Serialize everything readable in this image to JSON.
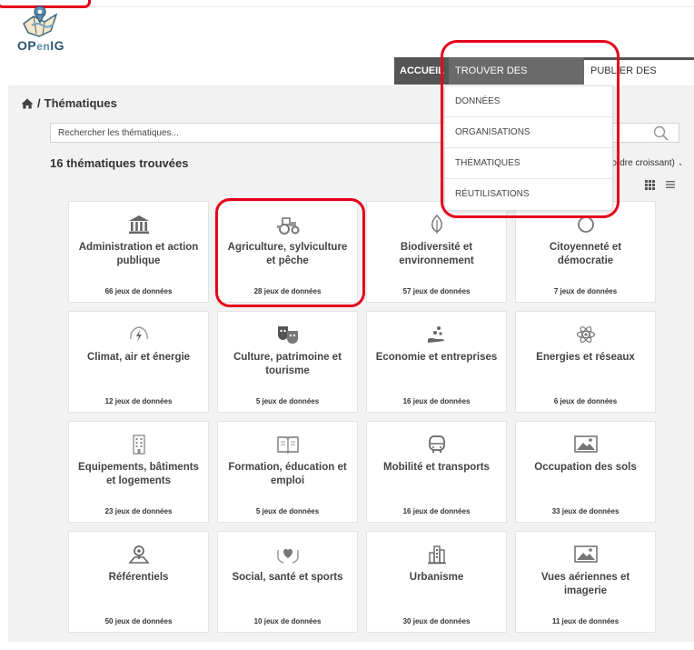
{
  "brand": {
    "logo_main": "OP",
    "logo_en": "en",
    "logo_end": "IG"
  },
  "nav": {
    "accueil": "ACCUEIL",
    "trouver": "TROUVER DES DONNÉES",
    "publier": "PUBLIER DES DONNÉES"
  },
  "dropdown": {
    "items": [
      "DONNÉES",
      "ORGANISATIONS",
      "THÉMATIQUES",
      "RÉUTILISATIONS"
    ]
  },
  "breadcrumb": {
    "separator": "/",
    "current": "Thématiques"
  },
  "search": {
    "placeholder": "Rechercher les thématiques..."
  },
  "results": {
    "count_label": "16 thématiques trouvées",
    "sort_label": "(ordre croissant) ⌄"
  },
  "colors": {
    "annotation": "#e3001b",
    "nav_dark": "#555555",
    "nav_mid": "#6a6a6a",
    "background": "#f2f2f2"
  },
  "themes": [
    {
      "icon": "bank-icon",
      "title": "Administration et action publique",
      "count": "66 jeux de données"
    },
    {
      "icon": "tractor-icon",
      "title": "Agriculture, sylviculture et pêche",
      "count": "28 jeux de données"
    },
    {
      "icon": "leaf-icon",
      "title": "Biodiversité et environnement",
      "count": "57 jeux de données"
    },
    {
      "icon": "circle-icon",
      "title": "Citoyenneté et démocratie",
      "count": "7 jeux de données"
    },
    {
      "icon": "wind-sun-icon",
      "title": "Climat, air et énergie",
      "count": "12 jeux de données"
    },
    {
      "icon": "theater-masks-icon",
      "title": "Culture, patrimoine et tourisme",
      "count": "5 jeux de données"
    },
    {
      "icon": "hand-coins-icon",
      "title": "Economie et entreprises",
      "count": "16 jeux de données"
    },
    {
      "icon": "atom-icon",
      "title": "Energies et réseaux",
      "count": "6 jeux de données"
    },
    {
      "icon": "building-icon",
      "title": "Equipements, bâtiments et logements",
      "count": "23 jeux de données"
    },
    {
      "icon": "book-icon",
      "title": "Formation, éducation et emploi",
      "count": "5 jeux de données"
    },
    {
      "icon": "bus-icon",
      "title": "Mobilité et transports",
      "count": "16 jeux de données"
    },
    {
      "icon": "image-icon",
      "title": "Occupation des sols",
      "count": "33 jeux de données"
    },
    {
      "icon": "map-pin-icon",
      "title": "Référentiels",
      "count": "50 jeux de données"
    },
    {
      "icon": "hands-heart-icon",
      "title": "Social, santé et sports",
      "count": "10 jeux de données"
    },
    {
      "icon": "city-icon",
      "title": "Urbanisme",
      "count": "30 jeux de données"
    },
    {
      "icon": "image-icon",
      "title": "Vues aériennes et imagerie",
      "count": "11 jeux de données"
    }
  ]
}
